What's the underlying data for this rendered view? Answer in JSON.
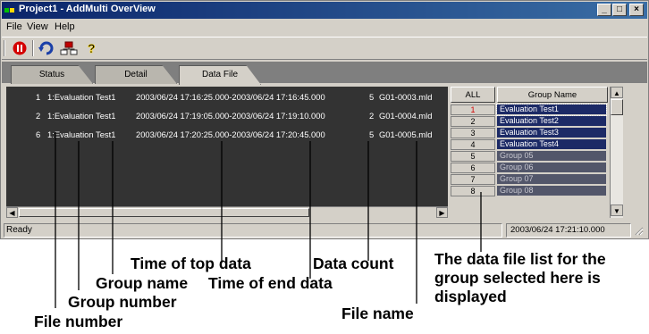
{
  "window": {
    "title": "Project1 - AddMulti OverView",
    "controls": {
      "minimize": "_",
      "maximize": "□",
      "close": "×"
    }
  },
  "menu": [
    "File",
    "View",
    "Help"
  ],
  "toolbar": {
    "buttons": [
      {
        "icon": "stop-icon",
        "color": "#d40000"
      },
      {
        "icon": "refresh-icon",
        "color": "#1a3fa8"
      },
      {
        "icon": "network-icon",
        "color": "#c00000"
      },
      {
        "icon": "help-icon",
        "symbol": "?"
      }
    ]
  },
  "tabs": [
    {
      "label": "Status",
      "active": false
    },
    {
      "label": "Detail",
      "active": false
    },
    {
      "label": "Data File",
      "active": true
    }
  ],
  "file_list": {
    "rows": [
      {
        "file_number": "1",
        "group": "1:Evaluation Test1",
        "time_range": "2003/06/24 17:16:25.000-2003/06/24 17:16:45.000",
        "count": "5",
        "file_name": "G01-0003.mld"
      },
      {
        "file_number": "2",
        "group": "1:Evaluation Test1",
        "time_range": "2003/06/24 17:19:05.000-2003/06/24 17:19:10.000",
        "count": "2",
        "file_name": "G01-0004.mld"
      },
      {
        "file_number": "6",
        "group": "1:Evaluation Test1",
        "time_range": "2003/06/24 17:20:25.000-2003/06/24 17:20:45.000",
        "count": "5",
        "file_name": "G01-0005.mld"
      }
    ],
    "scroll_left_arrow": "◀",
    "scroll_right_arrow": "▶"
  },
  "group_panel": {
    "all_label": "ALL",
    "header": "Group Name",
    "groups": [
      {
        "number": "1",
        "name": "Evaluation Test1",
        "selected": true
      },
      {
        "number": "2",
        "name": "Evaluation Test2"
      },
      {
        "number": "3",
        "name": "Evaluation Test3"
      },
      {
        "number": "4",
        "name": "Evaluation Test4"
      },
      {
        "number": "5",
        "name": "Group 05"
      },
      {
        "number": "6",
        "name": "Group 06"
      },
      {
        "number": "7",
        "name": "Group 07"
      },
      {
        "number": "8",
        "name": "Group 08"
      }
    ],
    "scroll_up_arrow": "▲",
    "scroll_down_arrow": "▼"
  },
  "statusbar": {
    "status": "Ready",
    "timestamp": "2003/06/24 17:21:10.000"
  },
  "annotations": {
    "time_of_top_data": "Time of top data",
    "data_count": "Data count",
    "group_name": "Group name",
    "time_of_end_data": "Time of end data",
    "group_number": "Group number",
    "file_number": "File number",
    "file_name": "File name",
    "group_selected": "The data file list for the group selected here is displayed"
  },
  "colors": {
    "titlebar_start": "#0a246a",
    "titlebar_end": "#3a6ea5",
    "face": "#d4d0c8",
    "list_bg": "#333333",
    "group_active_bg": "#1c2a66",
    "group_inactive_bg": "#52566a",
    "selected_number": "#d40000"
  }
}
